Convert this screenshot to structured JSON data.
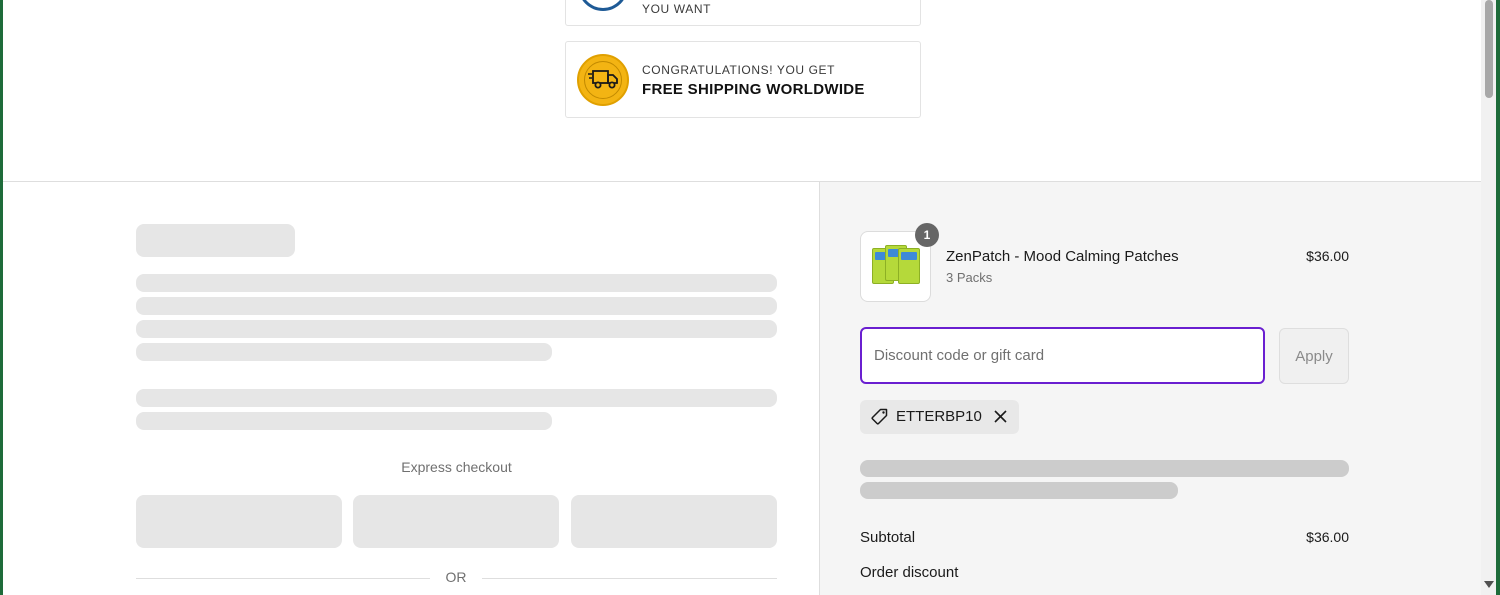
{
  "banners": [
    {
      "small_text": "YOU WANT",
      "big_text": "",
      "icon": "guarantee-badge-icon"
    },
    {
      "small_text": "CONGRATULATIONS! YOU GET",
      "big_text": "FREE SHIPPING WORLDWIDE",
      "icon": "delivery-truck-icon"
    }
  ],
  "checkout": {
    "express_label": "Express checkout",
    "or_text": "OR"
  },
  "order": {
    "item": {
      "name": "ZenPatch - Mood Calming Patches",
      "variant": "3 Packs",
      "price": "$36.00",
      "quantity": "1"
    },
    "discount": {
      "placeholder": "Discount code or gift card",
      "value": "",
      "apply_label": "Apply",
      "applied_code": "ETTERBP10"
    },
    "subtotal_label": "Subtotal",
    "subtotal_value": "$36.00",
    "order_discount_label": "Order discount"
  },
  "colors": {
    "accent": "#6a1fd0",
    "frame": "#1e6b3a",
    "shipping_badge": "#f3b413"
  }
}
